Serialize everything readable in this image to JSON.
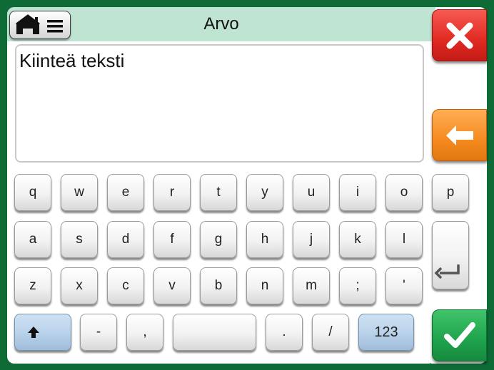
{
  "header": {
    "title": "Arvo"
  },
  "text_field": {
    "value": "Kiinteä teksti"
  },
  "keyboard": {
    "row1": [
      "q",
      "w",
      "e",
      "r",
      "t",
      "y",
      "u",
      "i",
      "o",
      "p"
    ],
    "row2": [
      "a",
      "s",
      "d",
      "f",
      "g",
      "h",
      "j",
      "k",
      "l"
    ],
    "row3": [
      "z",
      "x",
      "c",
      "v",
      "b",
      "n",
      "m",
      ";",
      "'"
    ],
    "row4": {
      "dash": "-",
      "comma": ",",
      "dot": ".",
      "slash": "/",
      "numeric": "123"
    }
  },
  "icons": {
    "home": "home-icon",
    "menu": "menu-icon",
    "cancel": "x-icon",
    "back": "arrow-left-icon",
    "enter": "enter-icon",
    "shift": "shift-up-arrow-icon",
    "ok": "checkmark-icon"
  },
  "colors": {
    "frame": "#0e6b35",
    "title_bar": "#bfe4d2",
    "cancel": "#e02a22",
    "back": "#f58a1f",
    "ok": "#1ea24c",
    "blue_key": "#b8d1ea"
  }
}
